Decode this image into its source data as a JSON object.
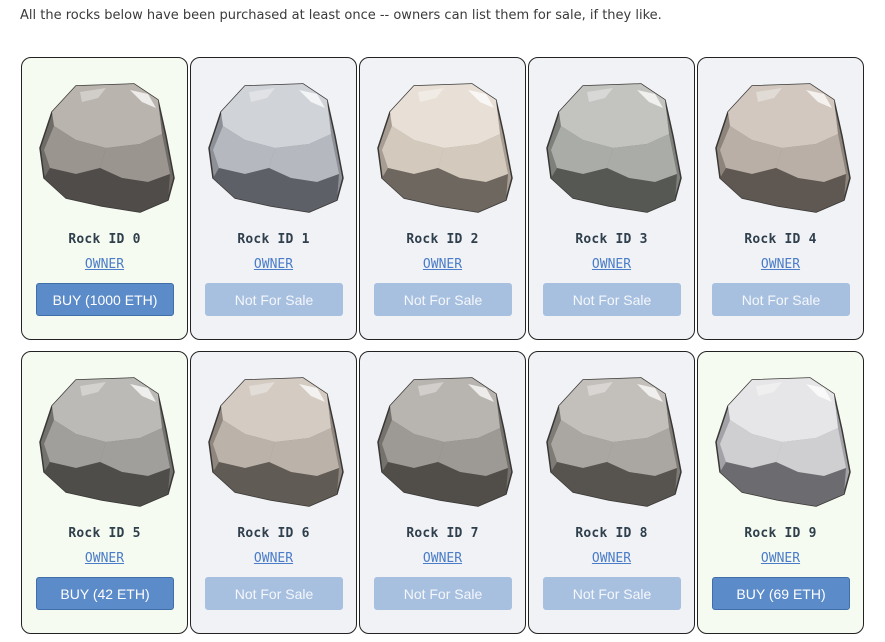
{
  "intro_text": "All the rocks below have been purchased at least once -- owners can list them for sale, if they like.",
  "rocks": [
    {
      "title": "Rock ID 0",
      "owner_label": "OWNER",
      "button_label": "BUY (1000 ETH)",
      "for_sale": true,
      "colors": {
        "light": "#b9b4ae",
        "mid": "#9b958f",
        "dark": "#6f6b66",
        "shadow": "#4f4c49"
      }
    },
    {
      "title": "Rock ID 1",
      "owner_label": "OWNER",
      "button_label": "Not For Sale",
      "for_sale": false,
      "colors": {
        "light": "#d0d3d8",
        "mid": "#b5b8be",
        "dark": "#8d9097",
        "shadow": "#5d6066"
      }
    },
    {
      "title": "Rock ID 2",
      "owner_label": "OWNER",
      "button_label": "Not For Sale",
      "for_sale": false,
      "colors": {
        "light": "#e8e0d6",
        "mid": "#d3c9bd",
        "dark": "#a79d92",
        "shadow": "#6e6760"
      }
    },
    {
      "title": "Rock ID 3",
      "owner_label": "OWNER",
      "button_label": "Not For Sale",
      "for_sale": false,
      "colors": {
        "light": "#c3c4c0",
        "mid": "#aaaca7",
        "dark": "#7e807b",
        "shadow": "#565854"
      }
    },
    {
      "title": "Rock ID 4",
      "owner_label": "OWNER",
      "button_label": "Not For Sale",
      "for_sale": false,
      "colors": {
        "light": "#d2c8c0",
        "mid": "#b9afa6",
        "dark": "#8d847c",
        "shadow": "#5f5852"
      }
    },
    {
      "title": "Rock ID 5",
      "owner_label": "OWNER",
      "button_label": "BUY (42 ETH)",
      "for_sale": true,
      "colors": {
        "light": "#bcbab6",
        "mid": "#a19f9b",
        "dark": "#74726e",
        "shadow": "#4f4d4a"
      }
    },
    {
      "title": "Rock ID 6",
      "owner_label": "OWNER",
      "button_label": "Not For Sale",
      "for_sale": false,
      "colors": {
        "light": "#d4cbc2",
        "mid": "#bbb2a9",
        "dark": "#8f877f",
        "shadow": "#615b55"
      }
    },
    {
      "title": "Rock ID 7",
      "owner_label": "OWNER",
      "button_label": "Not For Sale",
      "for_sale": false,
      "colors": {
        "light": "#b8b4b0",
        "mid": "#9d9994",
        "dark": "#75716c",
        "shadow": "#514e4a"
      }
    },
    {
      "title": "Rock ID 8",
      "owner_label": "OWNER",
      "button_label": "Not For Sale",
      "for_sale": false,
      "colors": {
        "light": "#c3bfbb",
        "mid": "#aaa6a1",
        "dark": "#7f7b76",
        "shadow": "#57544f"
      }
    },
    {
      "title": "Rock ID 9",
      "owner_label": "OWNER",
      "button_label": "BUY (69 ETH)",
      "for_sale": true,
      "colors": {
        "light": "#e6e6e8",
        "mid": "#cfcfd2",
        "dark": "#a3a3a7",
        "shadow": "#6c6c70"
      }
    }
  ]
}
